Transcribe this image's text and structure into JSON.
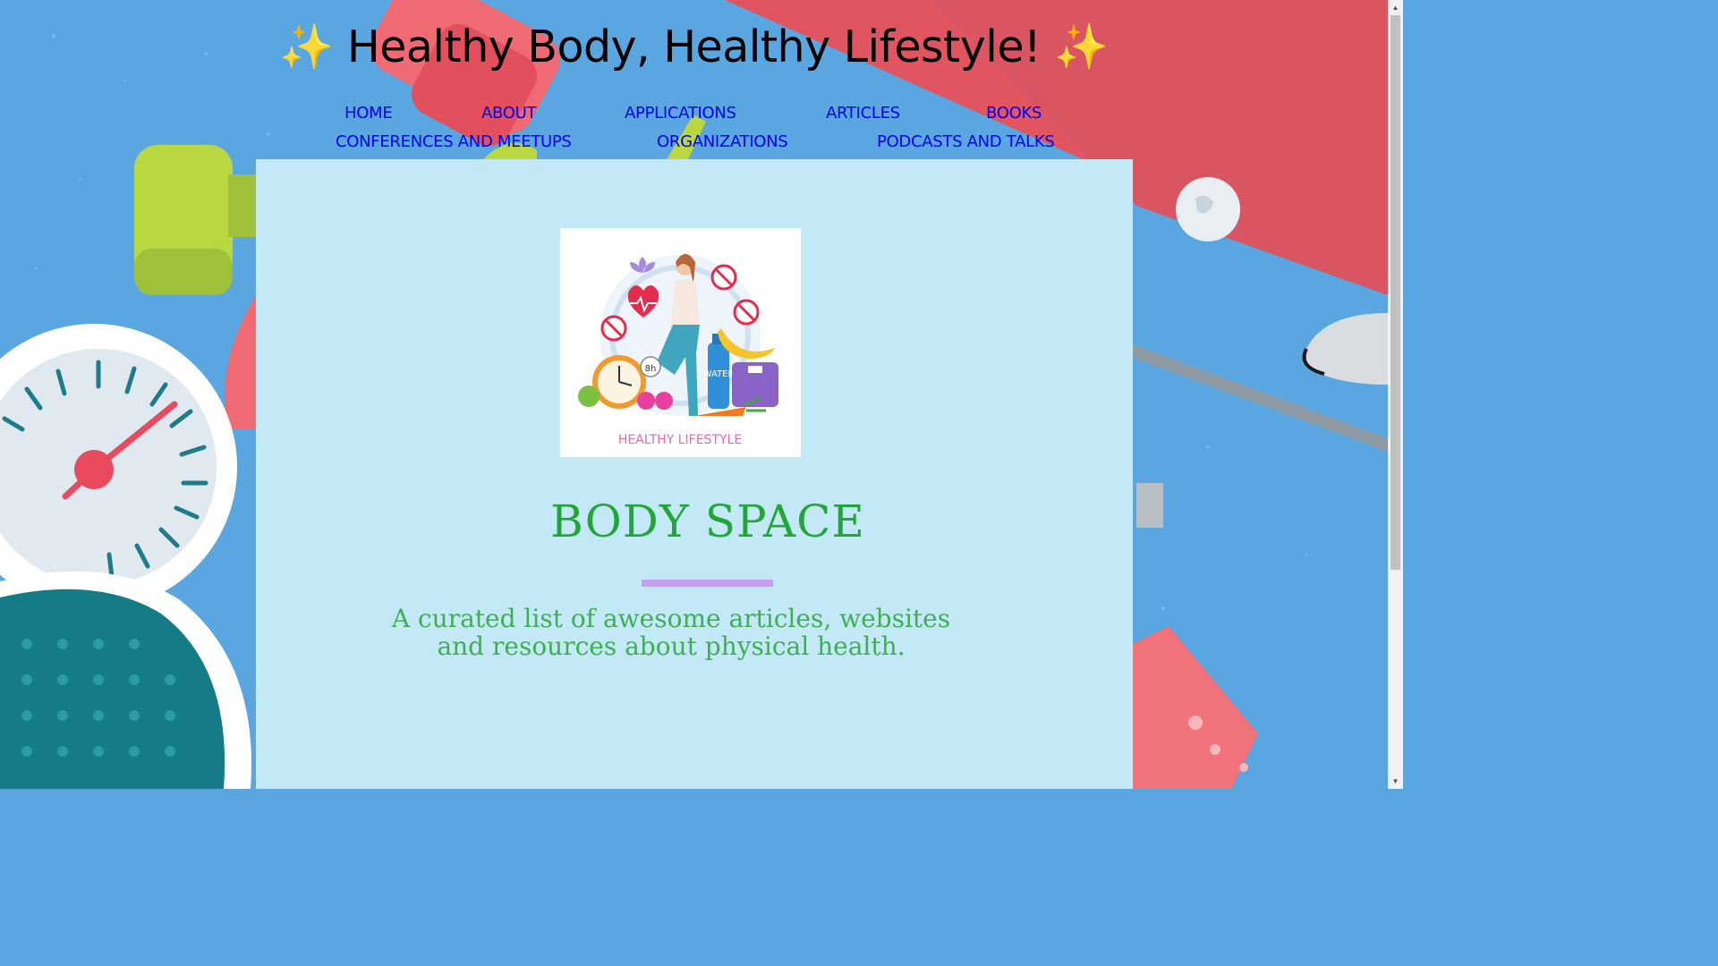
{
  "site": {
    "title": "Healthy Body, Healthy Lifestyle!",
    "sparkle_left": "✨",
    "sparkle_right": "✨"
  },
  "nav": {
    "home": "HOME",
    "about": "ABOUT",
    "applications": "APPLICATIONS",
    "articles": "ARTICLES",
    "books": "BOOKS",
    "conferences": "CONFERENCES AND MEETUPS",
    "organizations": "ORGANIZATIONS",
    "podcasts": "PODCASTS AND TALKS"
  },
  "hero": {
    "image_caption": "HEALTHY LIFESTYLE",
    "water_label": "WATER",
    "clock_badge": "8h",
    "brand": "BODY SPACE",
    "tagline": "A curated list of awesome articles, websites and resources about physical health."
  },
  "colors": {
    "page_background": "#5aa6e0",
    "panel_background": "#c3e9f7",
    "brand_green": "#22a63a",
    "divider_purple": "#c69ef0",
    "link_blue": "#0000ee"
  }
}
